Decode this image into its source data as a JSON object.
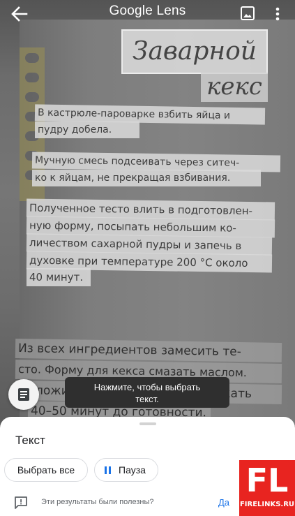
{
  "app": {
    "title": "Google Lens"
  },
  "topbar": {
    "back_icon": "arrow-back-icon",
    "gallery_icon": "image-icon",
    "more_icon": "more-vert-icon"
  },
  "photo": {
    "recipe_title": "Заварной",
    "recipe_subtitle": "кекс",
    "paragraphs": [
      [
        "В кастрюле-пароварке взбить яйца и",
        "пудру добела."
      ],
      [
        "Мучную смесь подсеивать через ситеч-",
        "ко к яйцам, не прекращая взбивания."
      ],
      [
        "Полученное тесто влить в подготовлен-",
        "ную форму, посыпать небольшим ко-",
        "личеством сахарной пудры и запечь в",
        "духовке при температуре 200 °С около",
        "40 минут."
      ],
      [
        "Из всех ингредиентов замесить те-",
        "сто. Форму для кекса смазать маслом.",
        "Выложить тесто в форму и выпекать",
        "40–50 минут до готовности."
      ]
    ]
  },
  "fab": {
    "icon": "text-selection-icon"
  },
  "toast": {
    "line1": "Нажмите, чтобы выбрать",
    "line2": "текст."
  },
  "sheet": {
    "title": "Текст",
    "select_all_label": "Выбрать все",
    "pause_label": "Пауза",
    "pause_icon": "pause-icon",
    "feedback_icon": "feedback-icon",
    "feedback_question": "Эти результаты были полезны?",
    "yes_label": "Да"
  },
  "watermark": {
    "mark": "FL",
    "domain": "FIRELINKS.RU"
  },
  "colors": {
    "accent": "#1a73e8",
    "watermark": "#e82420",
    "toast_bg": "#2f2f2f"
  }
}
